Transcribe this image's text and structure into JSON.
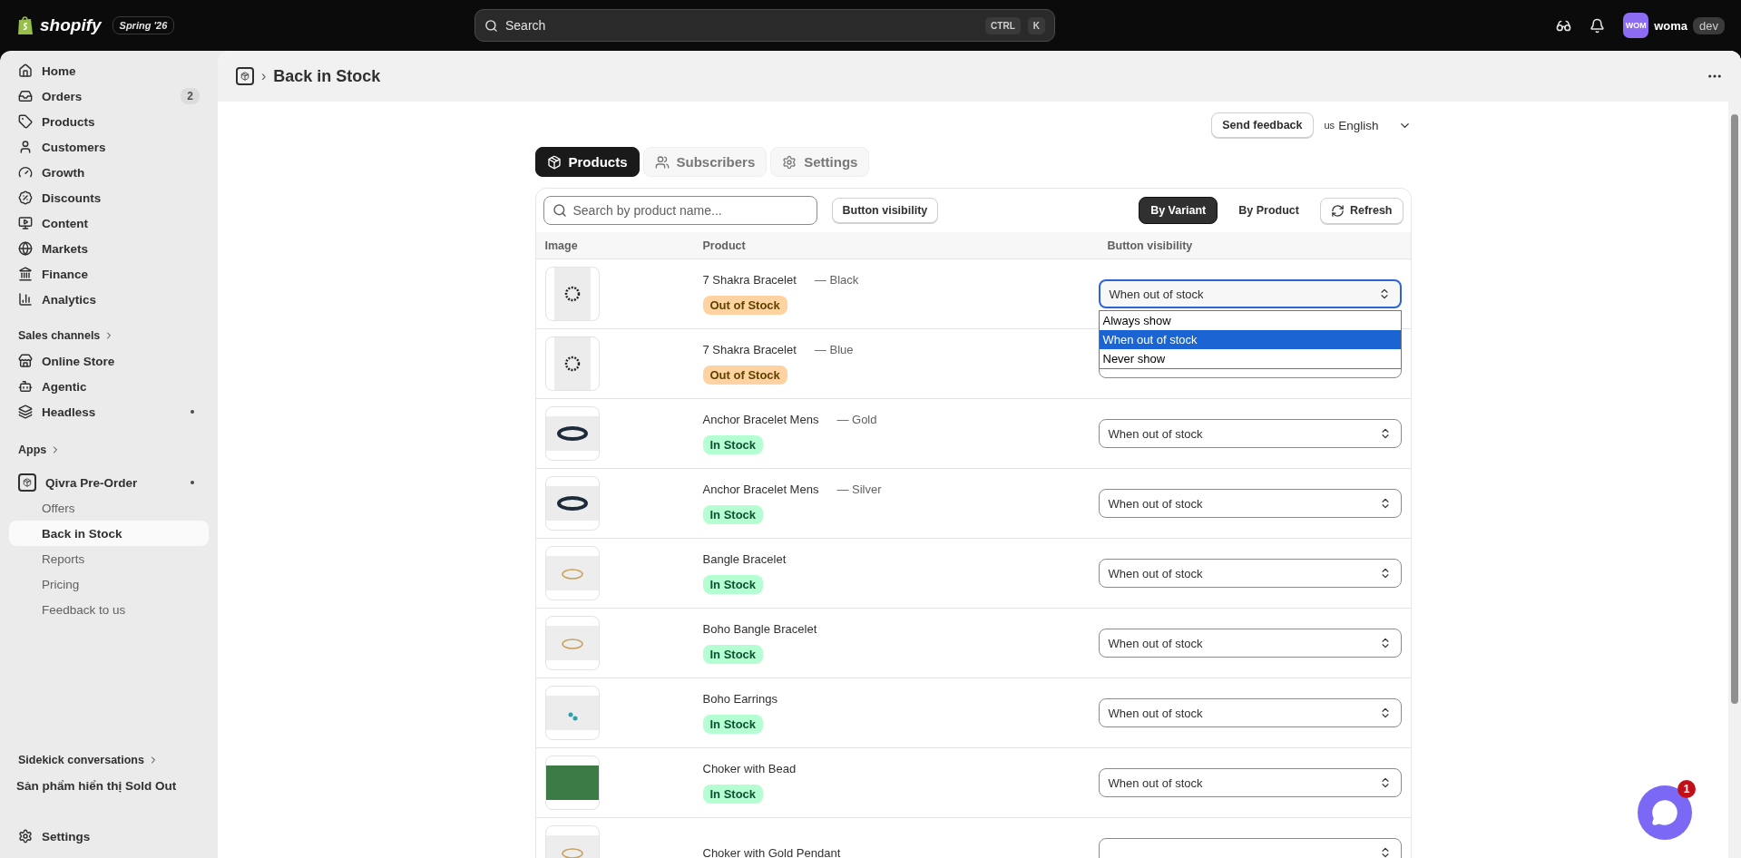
{
  "topbar": {
    "brand": "shopify",
    "edition": "Spring '26",
    "search": {
      "placeholder": "Search",
      "keys": [
        "CTRL",
        "K"
      ]
    },
    "avatar": "WOM",
    "user": "woma",
    "env": "dev"
  },
  "sidebar": {
    "main": [
      {
        "label": "Home",
        "selected": false
      },
      {
        "label": "Orders",
        "selected": false,
        "count": "2"
      },
      {
        "label": "Products",
        "selected": false
      },
      {
        "label": "Customers",
        "selected": false
      },
      {
        "label": "Growth",
        "selected": false
      },
      {
        "label": "Discounts",
        "selected": false
      },
      {
        "label": "Content",
        "selected": false
      },
      {
        "label": "Markets",
        "selected": false
      },
      {
        "label": "Finance",
        "selected": false
      },
      {
        "label": "Analytics",
        "selected": false
      }
    ],
    "channels_title": "Sales channels",
    "channels": [
      {
        "label": "Online Store",
        "dot": false
      },
      {
        "label": "Agentic",
        "dot": false
      },
      {
        "label": "Headless",
        "dot": true
      }
    ],
    "apps_title": "Apps",
    "app": {
      "label": "Qivra Pre-Order",
      "dot": true,
      "children": [
        {
          "label": "Offers",
          "selected": false
        },
        {
          "label": "Back in Stock",
          "selected": true
        },
        {
          "label": "Reports",
          "selected": false
        },
        {
          "label": "Pricing",
          "selected": false
        },
        {
          "label": "Feedback to us",
          "selected": false
        }
      ]
    },
    "sidekick_title": "Sidekick conversations",
    "sidekick_items": [
      "Sản phẩm hiển thị Sold Out"
    ],
    "settings": "Settings"
  },
  "header": {
    "separator": "›",
    "title": "Back in Stock"
  },
  "feedback_button": "Send feedback",
  "language": {
    "flag": "us",
    "label": "English"
  },
  "tabs": [
    {
      "label": "Products",
      "selected": true
    },
    {
      "label": "Subscribers",
      "selected": false
    },
    {
      "label": "Settings",
      "selected": false
    }
  ],
  "toolbar": {
    "search_placeholder": "Search by product name...",
    "visibility_button": "Button visibility",
    "views": [
      {
        "label": "By Variant",
        "selected": true
      },
      {
        "label": "By Product",
        "selected": false
      }
    ],
    "refresh": "Refresh"
  },
  "table": {
    "columns": [
      "Image",
      "Product",
      "Button visibility"
    ],
    "rows": [
      {
        "product": "7 Shakra Bracelet",
        "variant": "— Black",
        "status": {
          "kind": "out",
          "label": "Out of Stock"
        },
        "visibility": "When out of stock",
        "focused": true,
        "expanded": true
      },
      {
        "product": "7 Shakra Bracelet",
        "variant": "— Blue",
        "status": {
          "kind": "out",
          "label": "Out of Stock"
        },
        "focused": false,
        "expanded": false
      },
      {
        "product": "Anchor Bracelet Mens",
        "variant": "— Gold",
        "status": {
          "kind": "in",
          "label": "In Stock"
        },
        "visibility": "When out of stock",
        "focused": false,
        "expanded": false
      },
      {
        "product": "Anchor Bracelet Mens",
        "variant": "— Silver",
        "status": {
          "kind": "in",
          "label": "In Stock"
        },
        "visibility": "When out of stock",
        "focused": false,
        "expanded": false
      },
      {
        "product": "Bangle Bracelet",
        "status": {
          "kind": "in",
          "label": "In Stock"
        },
        "visibility": "When out of stock",
        "focused": false,
        "expanded": false
      },
      {
        "product": "Boho Bangle Bracelet",
        "status": {
          "kind": "in",
          "label": "In Stock"
        },
        "visibility": "When out of stock",
        "focused": false,
        "expanded": false
      },
      {
        "product": "Boho Earrings",
        "status": {
          "kind": "in",
          "label": "In Stock"
        },
        "visibility": "When out of stock",
        "focused": false,
        "expanded": false
      },
      {
        "product": "Choker with Bead",
        "status": {
          "kind": "in",
          "label": "In Stock"
        },
        "visibility": "When out of stock",
        "focused": false,
        "expanded": false
      },
      {
        "product": "Choker with Gold Pendant",
        "focused": false,
        "expanded": false
      }
    ]
  },
  "dropdown": {
    "options": [
      {
        "label": "Always show",
        "selected": false
      },
      {
        "label": "When out of stock",
        "selected": true
      },
      {
        "label": "Never show",
        "selected": false
      }
    ]
  },
  "chat": {
    "badge": "1"
  }
}
